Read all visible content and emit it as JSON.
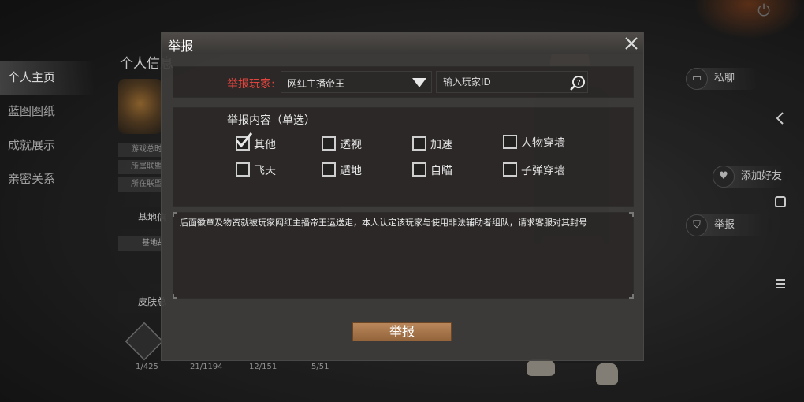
{
  "colors": {
    "accent_red": "#e2443d",
    "submit_bg": "#a8774b",
    "dialog_bg": "#3e3c3a"
  },
  "left_nav": {
    "items": [
      {
        "label": "个人主页",
        "active": true
      },
      {
        "label": "蓝图图纸",
        "active": false
      },
      {
        "label": "成就展示",
        "active": false
      },
      {
        "label": "亲密关系",
        "active": false
      }
    ]
  },
  "profile": {
    "title": "个人信息",
    "rows": [
      "游戏总时",
      "所属联盟",
      "所在联盟"
    ],
    "base_section": "基地信息",
    "base_row": "基地战力",
    "skin_section": "皮肤总数",
    "counts": [
      "1/425",
      "21/1194",
      "12/151",
      "5/51"
    ]
  },
  "side_actions": {
    "chat": {
      "label": "私聊",
      "icon": "chat-icon"
    },
    "add_friend": {
      "label": "添加好友",
      "icon": "heart-icon"
    },
    "report": {
      "label": "举报",
      "icon": "shield-icon"
    }
  },
  "dialog": {
    "title": "举报",
    "player_label": "举报玩家:",
    "selected_player": "网红主播帝王",
    "id_placeholder": "输入玩家ID",
    "content_title": "举报内容（单选）",
    "options": [
      {
        "label": "其他",
        "checked": true
      },
      {
        "label": "透视",
        "checked": false
      },
      {
        "label": "加速",
        "checked": false
      },
      {
        "label": "人物穿墙",
        "checked": false
      },
      {
        "label": "飞天",
        "checked": false
      },
      {
        "label": "遁地",
        "checked": false
      },
      {
        "label": "自瞄",
        "checked": false
      },
      {
        "label": "子弹穿墙",
        "checked": false
      }
    ],
    "reason_text": "后面徽章及物资就被玩家网红主播帝王运送走，本人认定该玩家与使用非法辅助者组队，请求客服对其封号",
    "submit_label": "举报"
  }
}
